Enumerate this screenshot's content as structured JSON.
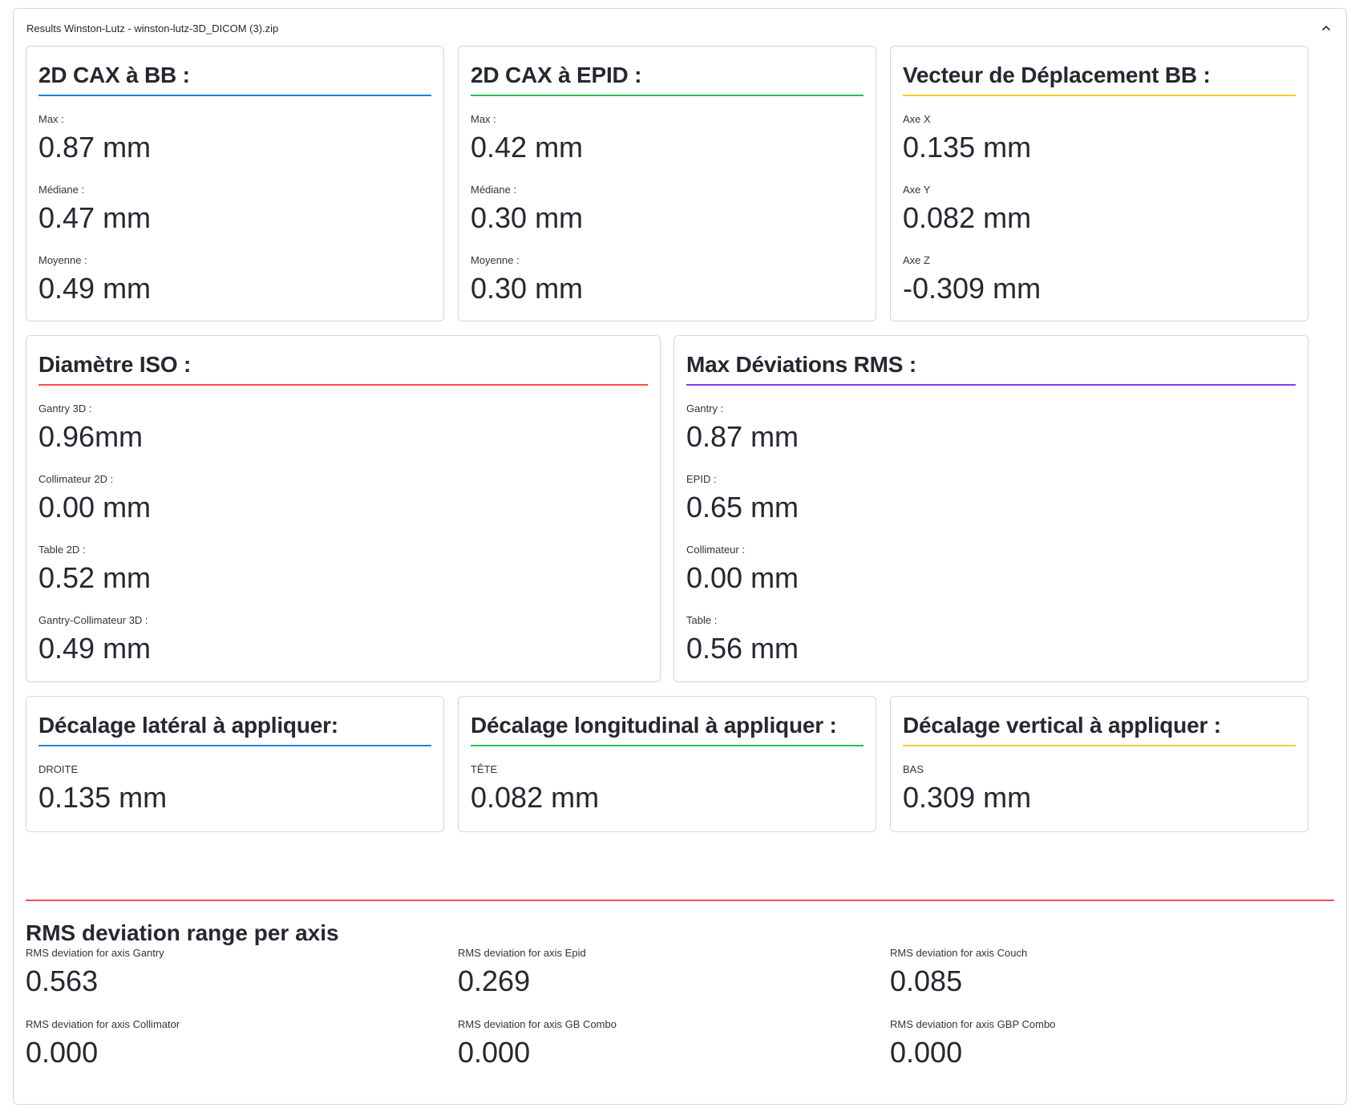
{
  "expander": {
    "title": "Results Winston-Lutz - winston-lutz-3D_DICOM (3).zip",
    "icon": "chevron-up-icon"
  },
  "cards": {
    "cax_bb": {
      "title": "2D CAX à BB :",
      "metrics": [
        {
          "label": "Max :",
          "value": "0.87 mm"
        },
        {
          "label": "Médiane :",
          "value": "0.47 mm"
        },
        {
          "label": "Moyenne :",
          "value": "0.49 mm"
        }
      ]
    },
    "cax_epid": {
      "title": "2D CAX à EPID :",
      "metrics": [
        {
          "label": "Max :",
          "value": "0.42 mm"
        },
        {
          "label": "Médiane :",
          "value": "0.30 mm"
        },
        {
          "label": "Moyenne :",
          "value": "0.30 mm"
        }
      ]
    },
    "vecteur": {
      "title": "Vecteur de Déplacement BB :",
      "metrics": [
        {
          "label": "Axe X",
          "value": "0.135 mm"
        },
        {
          "label": "Axe Y",
          "value": "0.082 mm"
        },
        {
          "label": "Axe Z",
          "value": "-0.309 mm"
        }
      ]
    },
    "diametre": {
      "title": "Diamètre ISO :",
      "metrics": [
        {
          "label": "Gantry 3D :",
          "value": "0.96mm"
        },
        {
          "label": "Collimateur 2D :",
          "value": "0.00 mm"
        },
        {
          "label": "Table 2D :",
          "value": "0.52 mm"
        },
        {
          "label": "Gantry-Collimateur 3D :",
          "value": "0.49 mm"
        }
      ]
    },
    "max_rms": {
      "title": "Max Déviations RMS :",
      "metrics": [
        {
          "label": "Gantry :",
          "value": "0.87 mm"
        },
        {
          "label": "EPID :",
          "value": "0.65 mm"
        },
        {
          "label": "Collimateur :",
          "value": "0.00 mm"
        },
        {
          "label": "Table :",
          "value": "0.56 mm"
        }
      ]
    },
    "lateral": {
      "title": "Décalage latéral à appliquer:",
      "metrics": [
        {
          "label": "DROITE",
          "value": "0.135 mm"
        }
      ]
    },
    "longitudinal": {
      "title": "Décalage longitudinal à appliquer :",
      "metrics": [
        {
          "label": "TÊTE",
          "value": "0.082 mm"
        }
      ]
    },
    "vertical": {
      "title": "Décalage vertical à appliquer :",
      "metrics": [
        {
          "label": "BAS",
          "value": "0.309 mm"
        }
      ]
    }
  },
  "rms_section": {
    "title": "RMS deviation range per axis",
    "metrics": [
      {
        "label": "RMS deviation for axis Gantry",
        "value": "0.563"
      },
      {
        "label": "RMS deviation for axis Epid",
        "value": "0.269"
      },
      {
        "label": "RMS deviation for axis Couch",
        "value": "0.085"
      },
      {
        "label": "RMS deviation for axis Collimator",
        "value": "0.000"
      },
      {
        "label": "RMS deviation for axis GB Combo",
        "value": "0.000"
      },
      {
        "label": "RMS deviation for axis GBP Combo",
        "value": "0.000"
      }
    ]
  },
  "colors": {
    "blue": "#1c83e1",
    "green": "#21c354",
    "orange": "#faca2b",
    "red": "#ff4b4b",
    "violet": "#803df5"
  }
}
